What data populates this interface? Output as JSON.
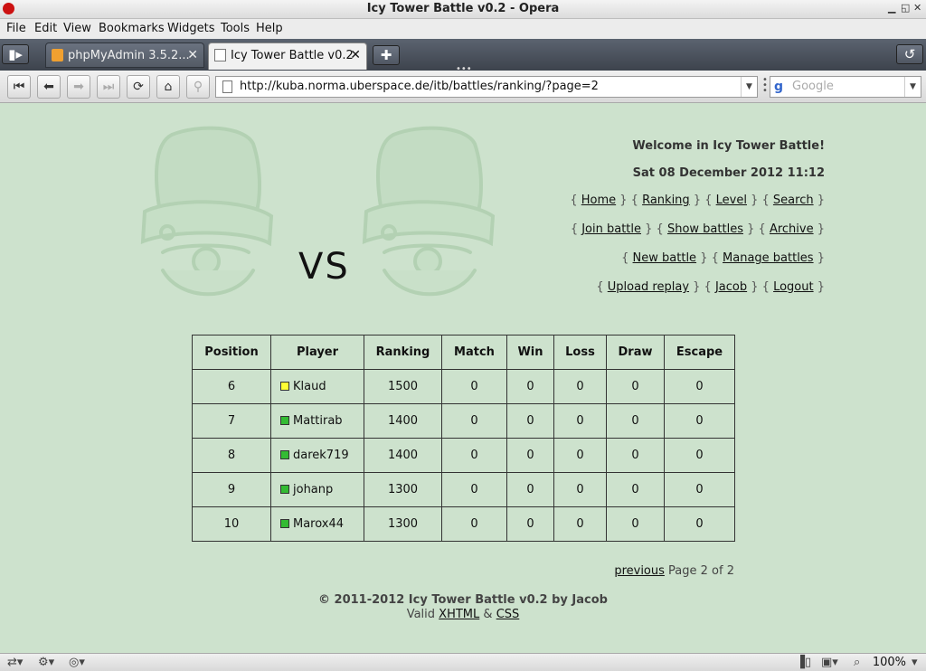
{
  "window": {
    "title": "Icy Tower Battle v0.2 - Opera"
  },
  "menu": [
    "File",
    "Edit",
    "View",
    "Bookmarks",
    "Widgets",
    "Tools",
    "Help"
  ],
  "tabs": [
    {
      "label": "phpMyAdmin 3.5.2...",
      "active": false
    },
    {
      "label": "Icy Tower Battle v0.2",
      "active": true
    }
  ],
  "address": {
    "url": "http://kuba.norma.uberspace.de/itb/battles/ranking/?page=2",
    "search_placeholder": "Google"
  },
  "header": {
    "vs": "VS",
    "welcome": "Welcome in Icy Tower Battle!",
    "datetime": "Sat 08 December 2012 11:12",
    "nav_row1": [
      "Home",
      "Ranking",
      "Level",
      "Search"
    ],
    "nav_row2": [
      "Join battle",
      "Show battles",
      "Archive"
    ],
    "nav_row3": [
      "New battle",
      "Manage battles"
    ],
    "nav_row4": [
      "Upload replay",
      "Jacob",
      "Logout"
    ]
  },
  "table": {
    "columns": [
      "Position",
      "Player",
      "Ranking",
      "Match",
      "Win",
      "Loss",
      "Draw",
      "Escape"
    ],
    "rows": [
      {
        "position": "6",
        "player": "Klaud",
        "color": "#ffff33",
        "ranking": "1500",
        "match": "0",
        "win": "0",
        "loss": "0",
        "draw": "0",
        "escape": "0"
      },
      {
        "position": "7",
        "player": "Mattirab",
        "color": "#33bb33",
        "ranking": "1400",
        "match": "0",
        "win": "0",
        "loss": "0",
        "draw": "0",
        "escape": "0"
      },
      {
        "position": "8",
        "player": "darek719",
        "color": "#33bb33",
        "ranking": "1400",
        "match": "0",
        "win": "0",
        "loss": "0",
        "draw": "0",
        "escape": "0"
      },
      {
        "position": "9",
        "player": "johanp",
        "color": "#33bb33",
        "ranking": "1300",
        "match": "0",
        "win": "0",
        "loss": "0",
        "draw": "0",
        "escape": "0"
      },
      {
        "position": "10",
        "player": "Marox44",
        "color": "#33bb33",
        "ranking": "1300",
        "match": "0",
        "win": "0",
        "loss": "0",
        "draw": "0",
        "escape": "0"
      }
    ]
  },
  "pager": {
    "previous": "previous",
    "page_text": "Page 2 of 2"
  },
  "footer": {
    "copyright": "© 2011-2012 Icy Tower Battle v0.2 by Jacob",
    "valid": "Valid",
    "xhtml": "XHTML",
    "amp": "&",
    "css": "CSS"
  },
  "statusbar": {
    "zoom": "100%"
  },
  "colors": {
    "page_bg": "#cde2cd",
    "tabbar_bg": "#4a515c"
  }
}
